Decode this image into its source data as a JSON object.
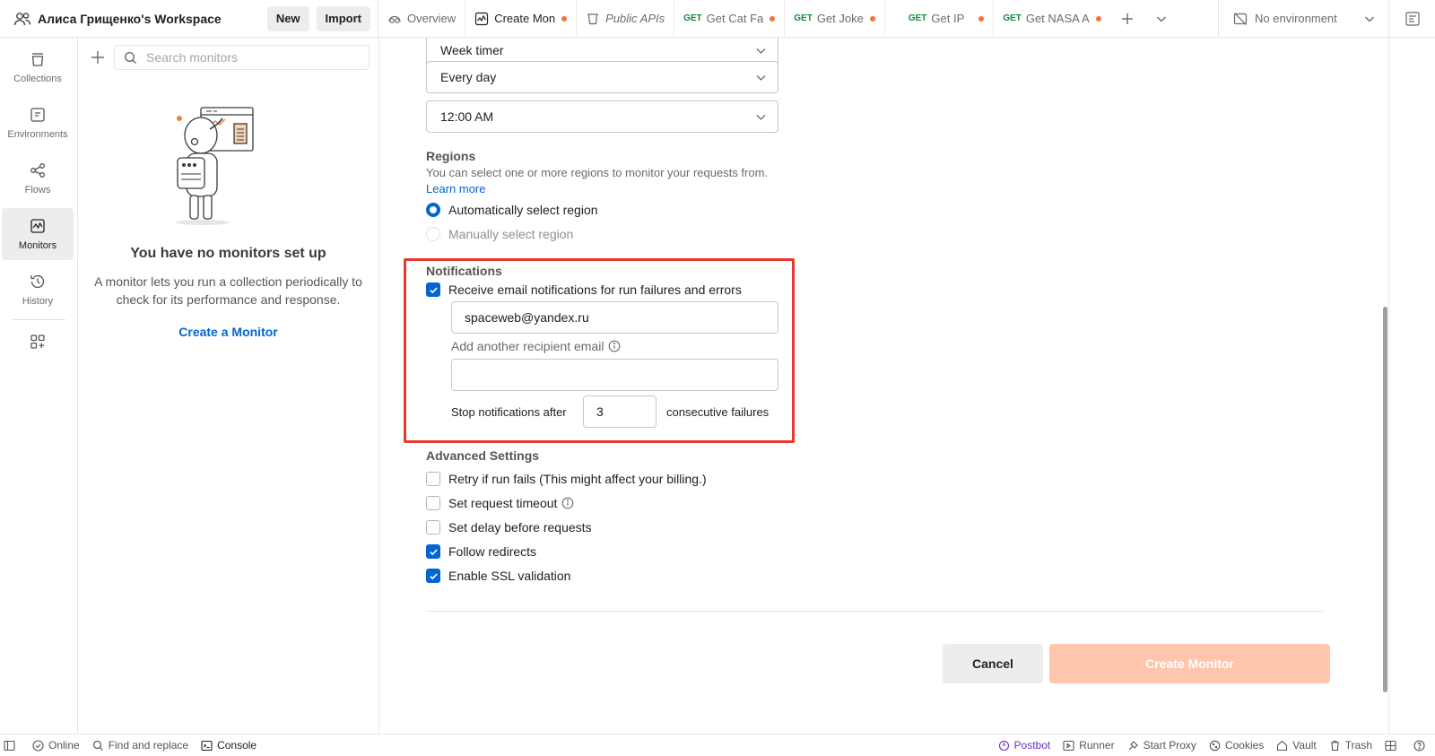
{
  "header": {
    "workspace_title": "Алиса Грищенко's Workspace",
    "new_label": "New",
    "import_label": "Import",
    "tabs": [
      {
        "label": "Overview",
        "method": "",
        "icon": "overview-icon"
      },
      {
        "label": "Create Mon",
        "method": "",
        "icon": "monitor-icon"
      },
      {
        "label": "Public APIs",
        "method": "",
        "icon": "public-apis-icon"
      },
      {
        "label": "Get Cat Fa",
        "method": "GET"
      },
      {
        "label": "Get Joke",
        "method": "GET"
      },
      {
        "label": "Get IP",
        "method": "GET"
      },
      {
        "label": "Get NASA A",
        "method": "GET"
      }
    ],
    "environment": "No environment"
  },
  "nav": {
    "items": [
      {
        "label": "Collections",
        "icon": "collections-icon"
      },
      {
        "label": "Environments",
        "icon": "environments-icon"
      },
      {
        "label": "Flows",
        "icon": "flows-icon"
      },
      {
        "label": "Monitors",
        "icon": "monitors-icon"
      },
      {
        "label": "History",
        "icon": "history-icon"
      }
    ]
  },
  "sidebar": {
    "search_placeholder": "Search monitors",
    "empty_title": "You have no monitors set up",
    "empty_desc": "A monitor lets you run a collection periodically to check for its performance and response.",
    "create_link": "Create a Monitor"
  },
  "form": {
    "partial_field": "Week timer",
    "frequency": "Every day",
    "time": "12:00 AM",
    "regions": {
      "title": "Regions",
      "help": "You can select one or more regions to monitor your requests from.",
      "learn_more": "Learn more",
      "auto_label": "Automatically select region",
      "manual_label": "Manually select region"
    },
    "notifications": {
      "title": "Notifications",
      "email_check_label": "Receive email notifications for run failures and errors",
      "email_value": "spaceweb@yandex.ru",
      "add_recipient_label": "Add another recipient email",
      "additional_email_value": "",
      "stop_after_label": "Stop notifications after",
      "stop_after_value": "3",
      "consecutive_label": "consecutive failures"
    },
    "advanced": {
      "title": "Advanced Settings",
      "options": [
        {
          "label": "Retry if run fails (This might affect your billing.)",
          "checked": false
        },
        {
          "label": "Set request timeout",
          "checked": false
        },
        {
          "label": "Set delay before requests",
          "checked": false
        },
        {
          "label": "Follow redirects",
          "checked": true
        },
        {
          "label": "Enable SSL validation",
          "checked": true
        }
      ]
    },
    "cancel_label": "Cancel",
    "create_label": "Create Monitor"
  },
  "statusbar": {
    "online": "Online",
    "find_replace": "Find and replace",
    "console": "Console",
    "postbot": "Postbot",
    "runner": "Runner",
    "start_proxy": "Start Proxy",
    "cookies": "Cookies",
    "vault": "Vault",
    "trash": "Trash"
  },
  "colors": {
    "accent": "#0265d2",
    "highlight": "#e8372b",
    "create_button": "#ffc5ad",
    "unsaved_dot": "#ff6c37",
    "get_method": "#0f8a3c"
  }
}
